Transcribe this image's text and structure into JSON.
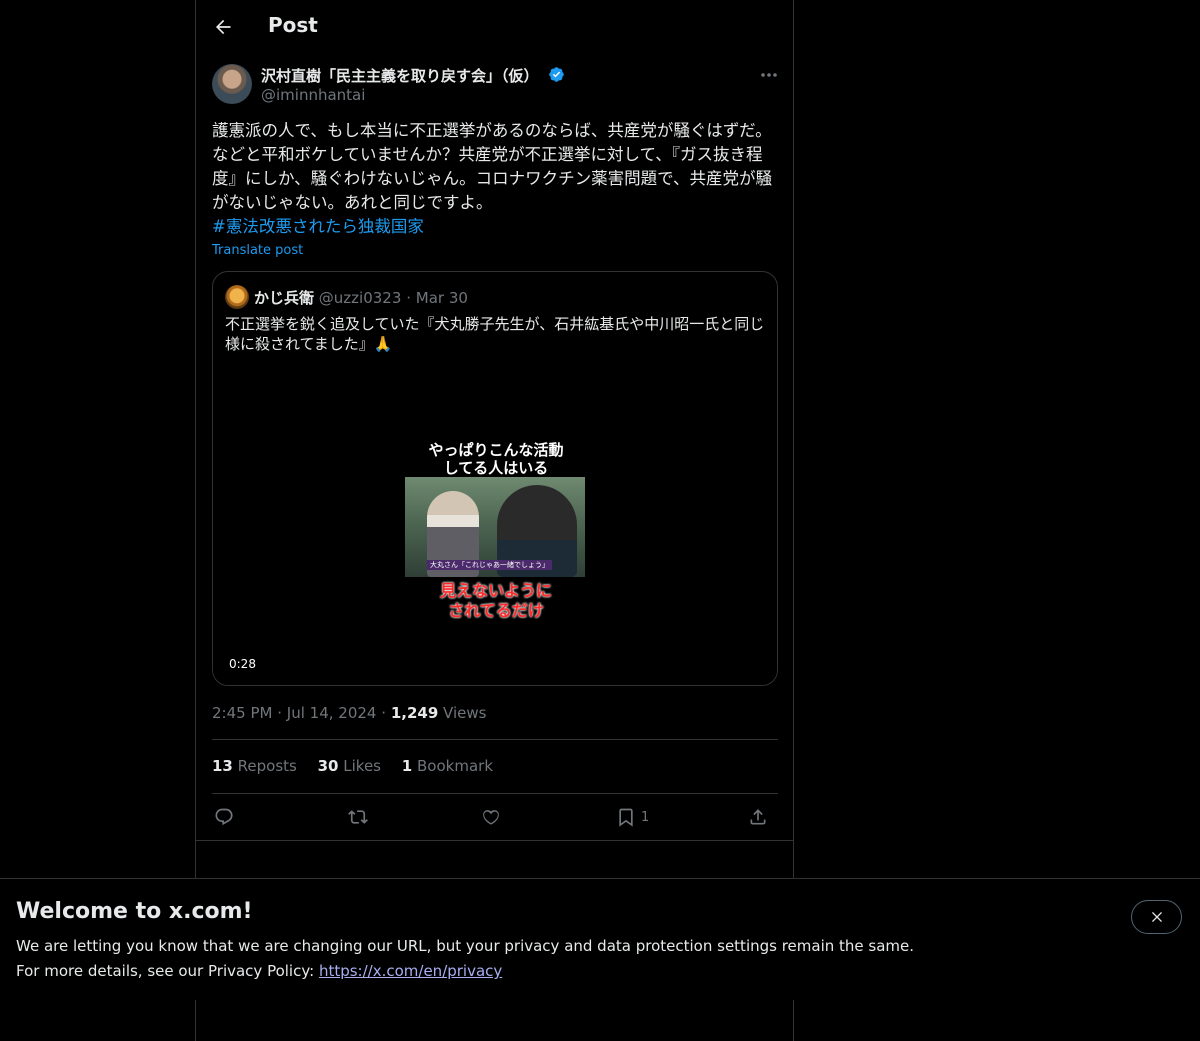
{
  "header": {
    "title": "Post"
  },
  "author": {
    "name": "沢村直樹「民主主義を取り戻す会」（仮）",
    "handle": "@iminnhantai"
  },
  "post": {
    "text": "護憲派の人で、もし本当に不正選挙があるのならば、共産党が騒ぐはずだ。などと平和ボケしていませんか？共産党が不正選挙に対して、『ガス抜き程度』にしか、騒ぐわけないじゃん。コロナワクチン薬害問題で、共産党が騒がないじゃない。あれと同じですよ。",
    "hashtag": "#憲法改悪されたら独裁国家",
    "translate_label": "Translate post"
  },
  "quote": {
    "name": "かじ兵衛",
    "handle": "@uzzi0323",
    "separator": "·",
    "date": "Mar 30",
    "text": "不正選挙を鋭く追及していた『犬丸勝子先生が、石井紘基氏や中川昭一氏と同じ様に殺されてました』🙏",
    "video": {
      "caption_top_1": "やっぱりこんな活動",
      "caption_top_2": "してる人はいる",
      "caption_bottom_1": "見えないように",
      "caption_bottom_2": "されてるだけ",
      "subtitle": "大丸さん「これじゃあ一緒でしょう」",
      "duration": "0:28"
    }
  },
  "meta": {
    "time": "2:45 PM",
    "separator": "·",
    "date": "Jul 14, 2024",
    "views_count": "1,249",
    "views_label": "Views"
  },
  "stats": {
    "reposts_count": "13",
    "reposts_label": "Reposts",
    "likes_count": "30",
    "likes_label": "Likes",
    "bookmarks_count": "1",
    "bookmarks_label": "Bookmark"
  },
  "actions": {
    "bookmark_count": "1"
  },
  "banner": {
    "title": "Welcome to x.com!",
    "line1": "We are letting you know that we are changing our URL, but your privacy and data protection settings remain the same.",
    "line2_prefix": "For more details, see our Privacy Policy: ",
    "link": "https://x.com/en/privacy"
  },
  "colors": {
    "accent": "#1d9bf0",
    "muted": "#71767b",
    "border": "#2f3336",
    "text": "#e7e9ea",
    "background": "#000000"
  },
  "icons": [
    "back-arrow-icon",
    "verified-badge-icon",
    "more-icon",
    "reply-icon",
    "repost-icon",
    "like-icon",
    "bookmark-icon",
    "share-icon",
    "close-icon"
  ]
}
